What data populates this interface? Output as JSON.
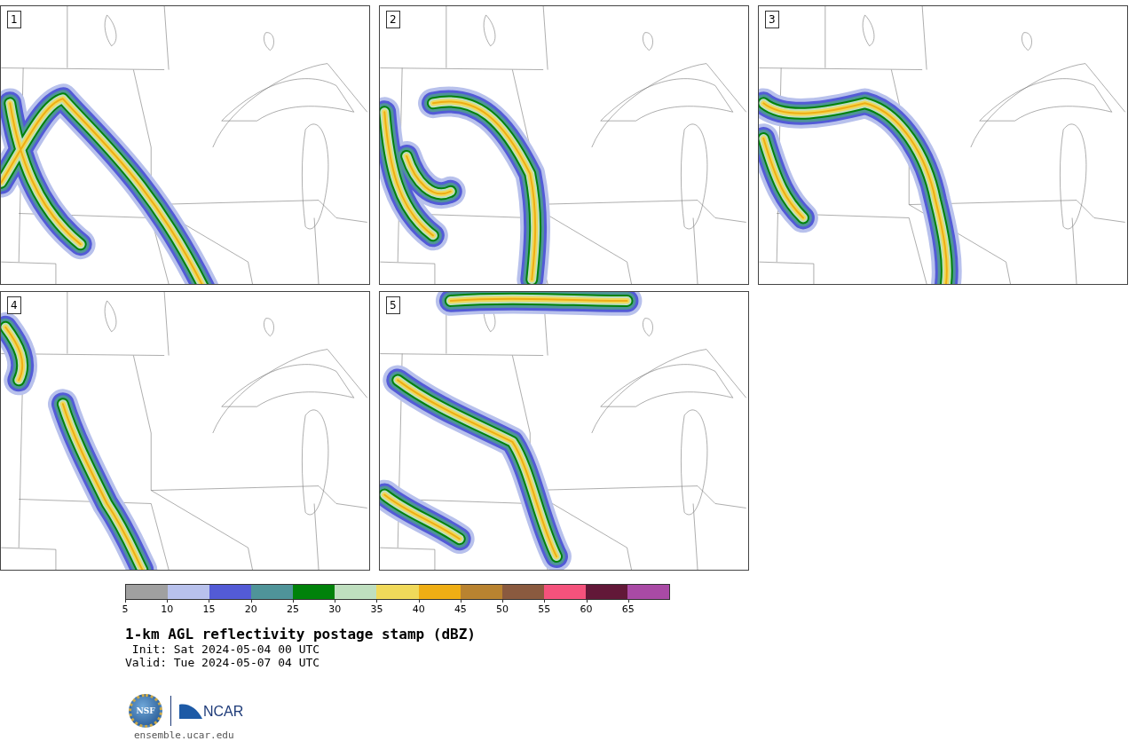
{
  "panels": [
    {
      "label": "1"
    },
    {
      "label": "2"
    },
    {
      "label": "3"
    },
    {
      "label": "4"
    },
    {
      "label": "5"
    }
  ],
  "colorbar": {
    "segments": [
      {
        "color": "#a0a0a0"
      },
      {
        "color": "#b8c1ec"
      },
      {
        "color": "#535bd6"
      },
      {
        "color": "#4f9499"
      },
      {
        "color": "#00820a"
      },
      {
        "color": "#bfdfbf"
      },
      {
        "color": "#f0d95a"
      },
      {
        "color": "#efae14"
      },
      {
        "color": "#b98330"
      },
      {
        "color": "#8a5a3f"
      },
      {
        "color": "#f4527c"
      },
      {
        "color": "#621838"
      },
      {
        "color": "#a94aa5"
      }
    ],
    "ticks": [
      "5",
      "10",
      "15",
      "20",
      "25",
      "30",
      "35",
      "40",
      "45",
      "50",
      "55",
      "60",
      "65"
    ]
  },
  "title": "1-km AGL reflectivity postage stamp (dBZ)",
  "init": " Init: Sat 2024-05-04 00 UTC",
  "valid": "Valid: Tue 2024-05-07 04 UTC",
  "logo": {
    "seal": "NSF",
    "name": "NCAR"
  },
  "footer_link": "ensemble.ucar.edu"
}
